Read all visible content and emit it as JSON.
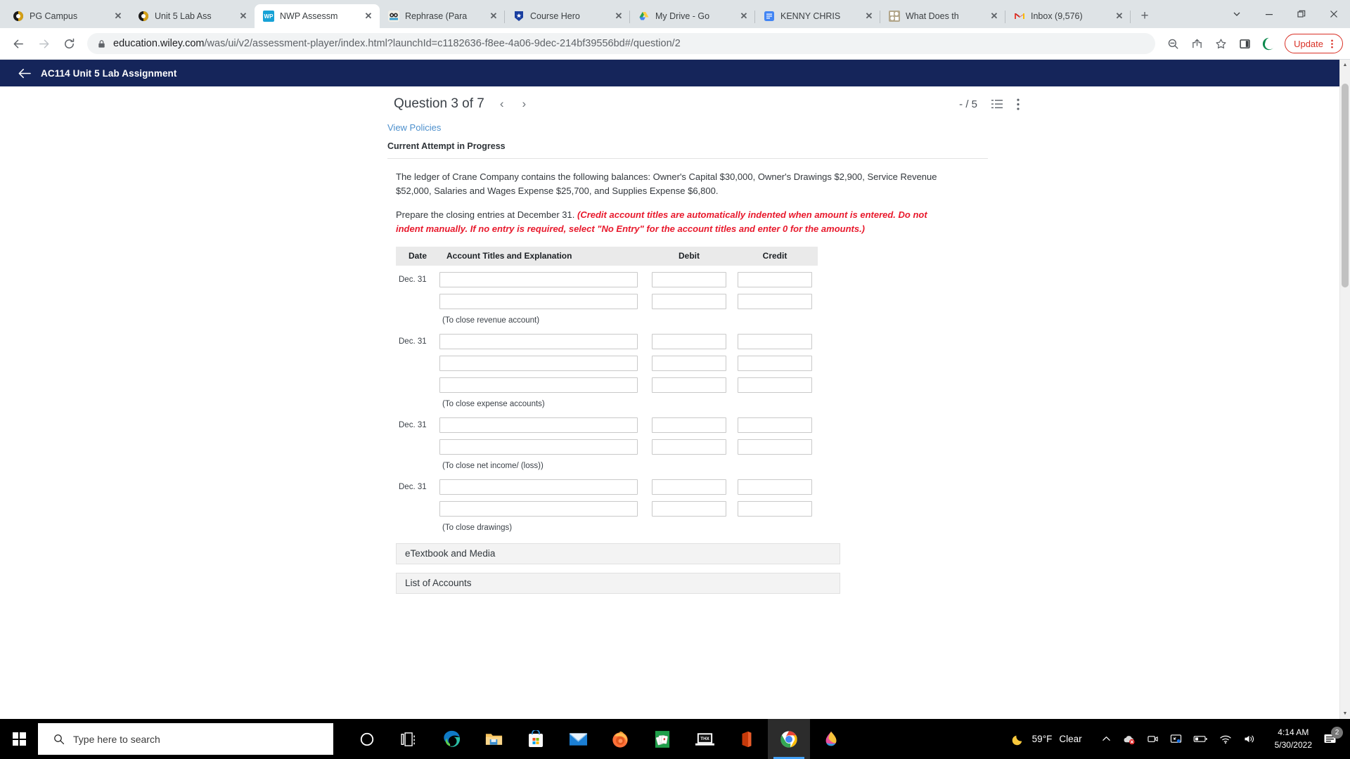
{
  "browser": {
    "tabs": [
      {
        "title": "PG Campus",
        "favicon": "pg-campus-icon",
        "active": false
      },
      {
        "title": "Unit 5 Lab Ass",
        "favicon": "pg-campus-icon",
        "active": false
      },
      {
        "title": "NWP Assessm",
        "favicon": "wiley-wp-icon",
        "active": true
      },
      {
        "title": "Rephrase (Para",
        "favicon": "quillbot-icon",
        "active": false
      },
      {
        "title": "Course Hero",
        "favicon": "course-hero-icon",
        "active": false
      },
      {
        "title": "My Drive - Go",
        "favicon": "google-drive-icon",
        "active": false
      },
      {
        "title": "KENNY CHRIS",
        "favicon": "google-docs-icon",
        "active": false
      },
      {
        "title": "What Does th",
        "favicon": "generic-site-icon",
        "active": false
      },
      {
        "title": "Inbox (9,576)",
        "favicon": "gmail-icon",
        "active": false
      }
    ],
    "new_tab_label": "+",
    "window_controls": {
      "tab_search": "v",
      "minimize": "—",
      "maximize": "❐",
      "close": "✕"
    },
    "toolbar": {
      "back": "←",
      "forward": "→",
      "reload": "⟳",
      "lock_icon": "lock-icon",
      "url_bold": "education.wiley.com",
      "url_rest": "/was/ui/v2/assessment-player/index.html?launchId=c1182636-f8ee-4a06-9dec-214bf39556bd#/question/2",
      "zoom_icon": "zoom-out-icon",
      "share_icon": "share-icon",
      "bookmark_icon": "star-icon",
      "sidepanel_icon": "side-panel-icon",
      "extension_icon": "extension-icon",
      "update_label": "Update",
      "menu_icon": "three-dot-menu-icon"
    }
  },
  "app": {
    "header": {
      "back_label": "←",
      "title": "AC114 Unit 5 Lab Assignment"
    },
    "question_bar": {
      "title": "Question 3 of 7",
      "prev": "‹",
      "next": "›",
      "score": "- / 5",
      "list_icon": "question-list-icon",
      "more_icon": "three-dot-menu-icon"
    },
    "view_policies": "View Policies",
    "attempt_status": "Current Attempt in Progress",
    "question_body": "The ledger of Crane Company contains the following balances: Owner's Capital $30,000, Owner's Drawings $2,900, Service Revenue $52,000, Salaries and Wages Expense $25,700, and Supplies Expense $6,800.",
    "instruction_lead": "Prepare the closing entries at December 31.",
    "instruction_hint": "(Credit account titles are automatically indented when amount is entered. Do not indent manually. If no entry is required, select \"No Entry\" for the account titles and enter 0 for the amounts.)",
    "journal": {
      "columns": [
        "Date",
        "Account Titles and Explanation",
        "Debit",
        "Credit"
      ],
      "blocks": [
        {
          "date": "Dec. 31",
          "rows": 2,
          "caption": "(To close revenue account)"
        },
        {
          "date": "Dec. 31",
          "rows": 3,
          "caption": "(To close expense accounts)"
        },
        {
          "date": "Dec. 31",
          "rows": 2,
          "caption": "(To close net income/ (loss))"
        },
        {
          "date": "Dec. 31",
          "rows": 2,
          "caption": "(To close drawings)"
        }
      ],
      "input_value": "",
      "input_placeholder": ""
    },
    "accordions": [
      {
        "label": "eTextbook and Media"
      },
      {
        "label": "List of Accounts"
      }
    ]
  },
  "taskbar": {
    "search_placeholder": "Type here to search",
    "search_icon": "search-icon",
    "cortana_icon": "cortana-icon",
    "taskview_icon": "task-view-icon",
    "apps": [
      {
        "name": "microsoft-edge"
      },
      {
        "name": "file-explorer"
      },
      {
        "name": "microsoft-store"
      },
      {
        "name": "mail"
      },
      {
        "name": "firefox"
      },
      {
        "name": "solitaire"
      },
      {
        "name": "thx-laptop"
      },
      {
        "name": "office"
      },
      {
        "name": "google-chrome",
        "active": true
      },
      {
        "name": "paint-3d"
      }
    ],
    "weather": {
      "icon": "moon-icon",
      "temp": "59°F",
      "condition": "Clear"
    },
    "tray_icons": [
      "chevron-up-icon",
      "cloud-error-icon",
      "camera-icon",
      "display-icon",
      "battery-icon",
      "wifi-icon",
      "volume-icon"
    ],
    "clock": {
      "time": "4:14 AM",
      "date": "5/30/2022"
    },
    "notifications": {
      "icon": "notification-icon",
      "count": "2"
    }
  }
}
